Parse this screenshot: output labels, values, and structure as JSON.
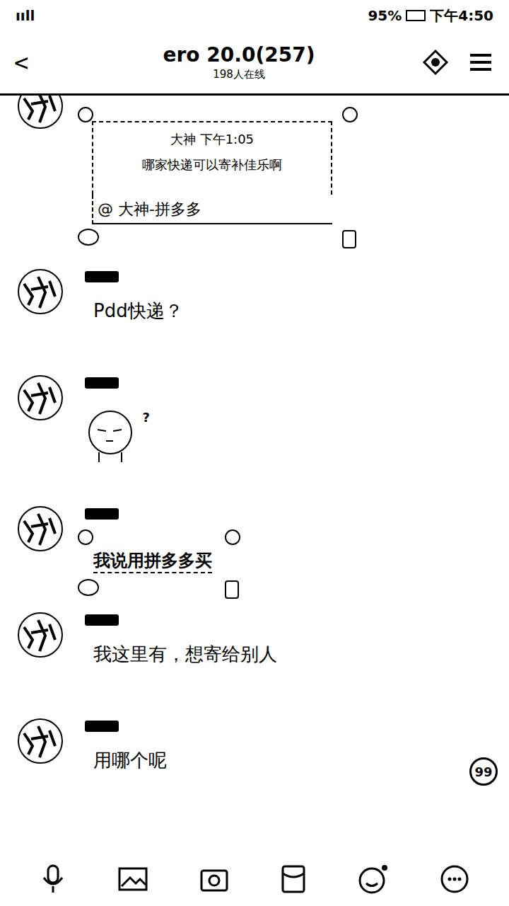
{
  "status_bar": {
    "signal": "ııll",
    "time": "下午4:50",
    "battery": "95%"
  },
  "header": {
    "back": "<",
    "title": "ero 20.0(257)",
    "subtitle": "198人在线"
  },
  "messages": [
    {
      "kind": "quote",
      "show_header": false,
      "quote_header": "大神 下午1:05",
      "quote_text": "哪家快递可以寄补佳乐啊",
      "text": "@ 大神-拼多多"
    },
    {
      "kind": "text",
      "show_header": true,
      "text": "Pdd快递？"
    },
    {
      "kind": "sticker",
      "show_header": true,
      "text": "?"
    },
    {
      "kind": "fancy",
      "show_header": true,
      "text": "我说用拼多多买"
    },
    {
      "kind": "text",
      "show_header": true,
      "text": "我这里有，想寄给别人"
    },
    {
      "kind": "text",
      "show_header": true,
      "text": "用哪个呢"
    }
  ],
  "unread_badge": "99"
}
